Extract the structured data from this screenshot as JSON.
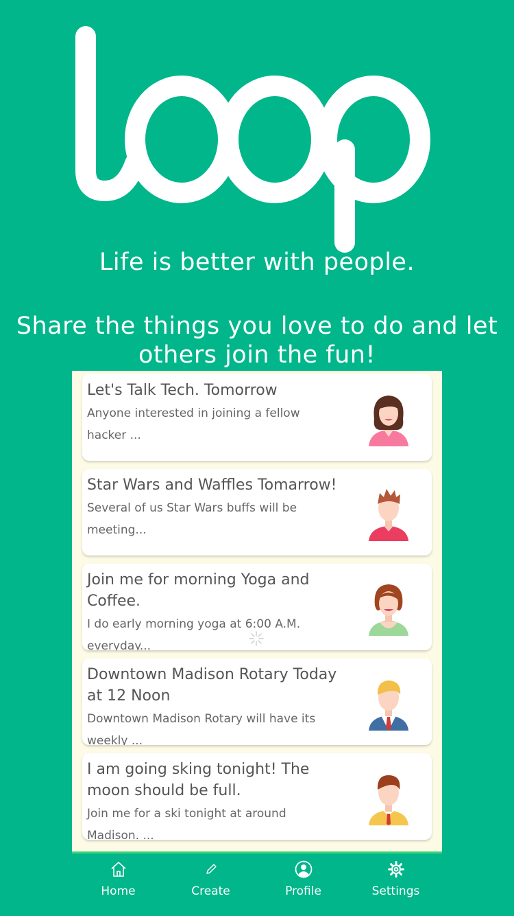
{
  "app": {
    "logo_text": "loop",
    "tagline_primary": "Life is better with people.",
    "tagline_secondary": "Share the things you love to do and let others join the fun!"
  },
  "feed": {
    "items": [
      {
        "title": "Let's Talk Tech. Tomorrow",
        "description": "Anyone interested in joining a fellow hacker ...",
        "avatar": "woman-brown-hair-pink-shirt-avatar"
      },
      {
        "title": "Star Wars and Waffles Tomarrow!",
        "description": "Several of us Star Wars buffs will be meeting...",
        "avatar": "man-spiky-hair-red-shirt-avatar"
      },
      {
        "title": "Join me for morning Yoga and Coffee.",
        "description": "I do early morning yoga at 6:00 A.M. everyday...",
        "avatar": "woman-auburn-hair-green-top-avatar"
      },
      {
        "title": "Downtown Madison Rotary Today at 12 Noon",
        "description": "Downtown Madison Rotary will have its weekly ...",
        "avatar": "man-blond-suit-tie-avatar"
      },
      {
        "title": "I am going sking tonight! The moon should be full.",
        "description": "Join me for a ski tonight at around Madison. ...",
        "avatar": "man-brown-hair-yellow-shirt-avatar"
      }
    ]
  },
  "tabbar": {
    "tabs": [
      {
        "label": "Home",
        "icon": "home-icon"
      },
      {
        "label": "Create",
        "icon": "pencil-icon"
      },
      {
        "label": "Profile",
        "icon": "profile-icon"
      },
      {
        "label": "Settings",
        "icon": "gear-icon"
      }
    ]
  },
  "colors": {
    "brand": "#00b68a",
    "feed_background": "#fdfbe6",
    "card_background": "#ffffff",
    "tab_indicator": "#3fd47c"
  }
}
